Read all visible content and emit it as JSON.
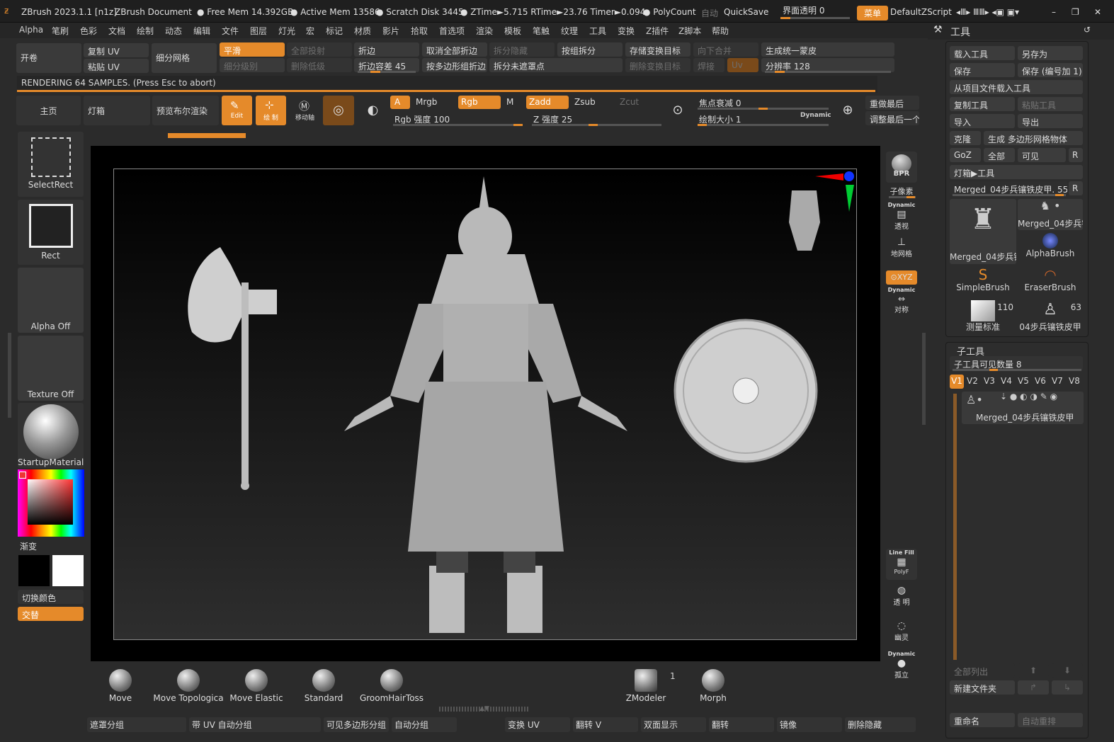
{
  "topbar": {
    "app": "ZBrush 2023.1.1 [n1z]",
    "doc": "ZBrush Document",
    "free_mem": "Free Mem 14.392GB",
    "active_mem": "Active Mem 13586",
    "scratch": "Scratch Disk 3445",
    "ztime": "ZTime►5.715 RTime►23.76 Timer►0.094",
    "polycount": "PolyCount",
    "auto": "自动",
    "quicksave": "QuickSave",
    "transparency": "界面透明 0",
    "menu": "菜单",
    "script": "DefaultZScript"
  },
  "menus": [
    "Alpha",
    "笔刷",
    "色彩",
    "文档",
    "绘制",
    "动态",
    "编辑",
    "文件",
    "图层",
    "灯光",
    "宏",
    "标记",
    "材质",
    "影片",
    "拾取",
    "首选项",
    "渲染",
    "模板",
    "笔触",
    "纹理",
    "工具",
    "变换",
    "Z插件",
    "Z脚本",
    "帮助"
  ],
  "tool_header": "工具",
  "row1": {
    "open": "开卷",
    "copy_uv": "复制 UV",
    "paste_uv": "粘贴 UV",
    "subdiv_mesh": "细分网格",
    "smooth": "平滑",
    "subdiv_level": "细分级别",
    "project_all": "全部投射",
    "delete_lower": "删除低级",
    "crease": "折边",
    "crease_tol": "折边容差 45",
    "uncrease_all": "取消全部折边",
    "crease_by_poly": "按多边形组折边",
    "split_hidden": "拆分隐藏",
    "split_unmasked": "拆分未遮罩点",
    "split_groups": "按组拆分",
    "store_morph": "存储变换目标",
    "delete_morph": "删除变换目标",
    "merge_down": "向下合并",
    "weld": "焊接",
    "uv": "Uv",
    "unified_skin": "生成统一蒙皮",
    "resolution": "分辨率 128"
  },
  "render_status": "RENDERING 64 SAMPLES. (Press Esc to abort)",
  "row2": {
    "home": "主页",
    "lightbox": "灯箱",
    "preview_bpr": "预览布尔渲染",
    "edit": "Edit",
    "draw": "绘 制",
    "move": "移动轴",
    "a": "A",
    "mrgb": "Mrgb",
    "rgb": "Rgb",
    "m": "M",
    "zadd": "Zadd",
    "zsub": "Zsub",
    "zcut": "Zcut",
    "rgb_intensity": "Rgb 强度 100",
    "z_intensity": "Z 强度 25",
    "focal_shift": "焦点衰减 0",
    "draw_size": "绘制大小 1",
    "dynamic": "Dynamic",
    "redo_last": "重做最后",
    "adjust_last": "调整最后一个"
  },
  "left": {
    "select_rect": "SelectRect",
    "rect": "Rect",
    "alpha_off": "Alpha Off",
    "texture_off": "Texture Off",
    "material": "StartupMaterial",
    "gradient": "渐变",
    "switch_color": "切换颜色",
    "alternate": "交替"
  },
  "rightshelf": {
    "bpr": "BPR",
    "subpixel": "子像素",
    "dynamic": "Dynamic",
    "perspective": "透视",
    "floor": "地网格",
    "xyz": "XYZ",
    "symmetry": "对称",
    "linefill": "Line Fill",
    "polyf": "PolyF",
    "transparent": "透 明",
    "ghost": "幽灵",
    "solo": "孤立"
  },
  "toolpanel": {
    "load_tool": "载入工具",
    "save_as": "另存为",
    "save": "保存",
    "save_inc": "保存 (编号加 1)",
    "load_from_project": "从项目文件载入工具",
    "copy_tool": "复制工具",
    "paste_tool": "粘贴工具",
    "import": "导入",
    "export": "导出",
    "clone": "克隆",
    "make_polymesh": "生成 多边形网格物体",
    "goz": "GoZ",
    "all": "全部",
    "visible": "可见",
    "r": "R",
    "lightbox_tool": "灯箱▶工具",
    "current_tool": "Merged_04步兵镶铁皮甲. 55",
    "thumbs": [
      {
        "label": "Merged_04步兵镶",
        "count": ""
      },
      {
        "label": "Merged_04步兵镶",
        "count": ""
      },
      {
        "label": "AlphaBrush",
        "count": ""
      },
      {
        "label": "SimpleBrush",
        "count": ""
      },
      {
        "label": "EraserBrush",
        "count": ""
      },
      {
        "label": "测量标准",
        "count": "110"
      },
      {
        "label": "04步兵镶铁皮甲",
        "count": "63"
      }
    ]
  },
  "subtool": {
    "header": "子工具",
    "visible_count": "子工具可见数量 8",
    "versions": [
      "V1",
      "V2",
      "V3",
      "V4",
      "V5",
      "V6",
      "V7",
      "V8"
    ],
    "item": "Merged_04步兵镶铁皮甲",
    "list_all": "全部列出",
    "new_folder": "新建文件夹",
    "rename": "重命名",
    "auto_reorder": "自动重排"
  },
  "brushes": [
    {
      "name": "Move"
    },
    {
      "name": "Move Topologica"
    },
    {
      "name": "Move Elastic"
    },
    {
      "name": "Standard"
    },
    {
      "name": "GroomHairToss"
    },
    {
      "name": "ZModeler",
      "count": "1"
    },
    {
      "name": "Morph"
    }
  ],
  "bottom": [
    "遮罩分组",
    "带 UV 自动分组",
    "可见多边形分组",
    "自动分组",
    "变换 UV",
    "翻转 V",
    "双面显示",
    "翻转",
    "镜像",
    "删除隐藏"
  ],
  "colors": {
    "accent": "#e58a2a",
    "bg": "#2b2b2b",
    "panel": "#3a3a3a"
  }
}
